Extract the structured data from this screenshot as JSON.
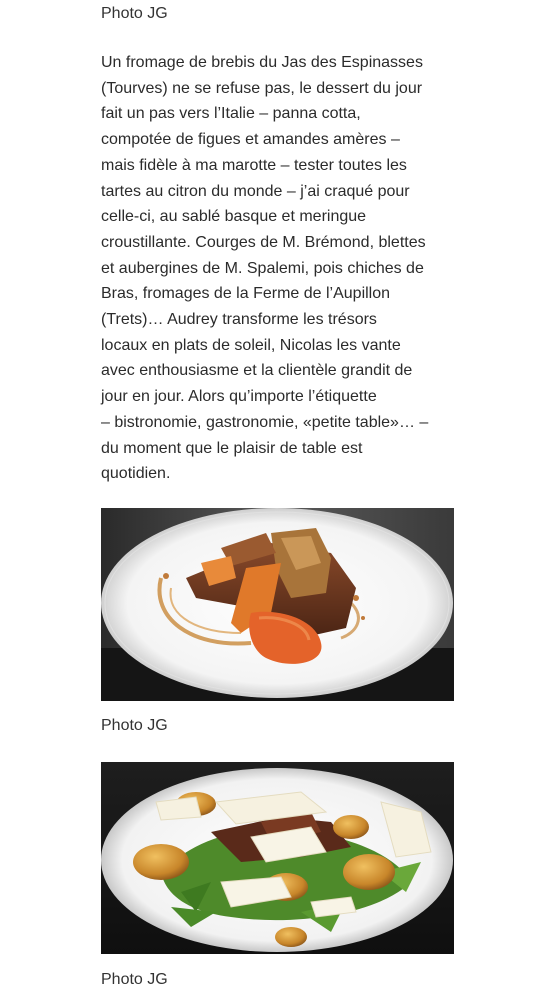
{
  "captions": {
    "top": "Photo JG",
    "middle": "Photo JG",
    "bottom": "Photo JG"
  },
  "article": {
    "lines": [
      "Un fromage de brebis du Jas des Espinasses",
      "(Tourves) ne se refuse pas, le dessert du jour",
      "fait un pas vers l’Italie – panna cotta,",
      "compotée de figues et amandes amères –",
      "mais fidèle à ma marotte – tester toutes les",
      "tartes au citron du monde – j’ai craqué pour",
      "celle-ci, au sablé basque et meringue",
      "croustillante. Courges de M. Brémond, blettes",
      "et aubergines de M. Spalemi, pois chiches de",
      "Bras, fromages de la Ferme de l’Aupillon",
      "(Trets)… Audrey transforme les trésors",
      "locaux en plats de soleil, Nicolas les vante",
      "avec enthousiasme et la clientèle grandit de",
      "jour en jour. Alors qu’importe l’étiquette",
      "– bistronomie, gastronomie, «petite table»… –",
      "du moment que le plaisir de table est",
      "quotidien."
    ]
  },
  "photos": {
    "first": {
      "subject": "plate-meat-pumpkin-sauce"
    },
    "second": {
      "subject": "plate-salad-potatoes-parmesan"
    }
  },
  "colors": {
    "text": "#2b2b2b",
    "caption": "#333333",
    "background": "#ffffff"
  }
}
